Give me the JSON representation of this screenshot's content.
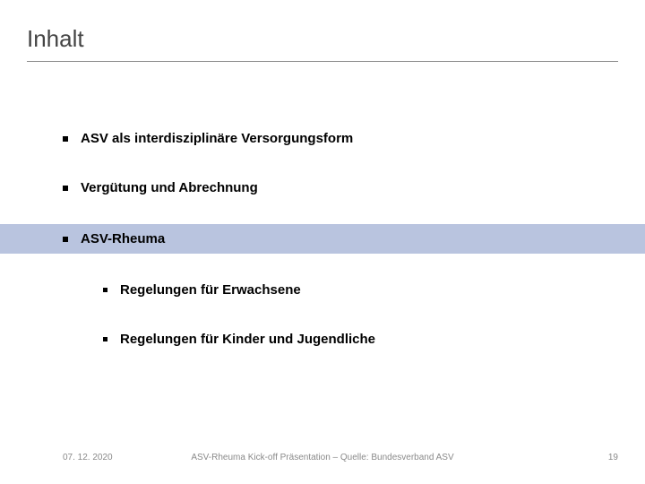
{
  "title": "Inhalt",
  "items": [
    {
      "label": "ASV als interdisziplinäre Versorgungsform",
      "highlight": false,
      "sub": false
    },
    {
      "label": "Vergütung und Abrechnung",
      "highlight": false,
      "sub": false
    },
    {
      "label": "ASV-Rheuma",
      "highlight": true,
      "sub": false
    },
    {
      "label": "Regelungen für Erwachsene",
      "highlight": false,
      "sub": true
    },
    {
      "label": "Regelungen für Kinder und Jugendliche",
      "highlight": false,
      "sub": true
    }
  ],
  "footer": {
    "date": "07. 12. 2020",
    "center": "ASV-Rheuma Kick-off Präsentation – Quelle: Bundesverband ASV",
    "page": "19"
  }
}
